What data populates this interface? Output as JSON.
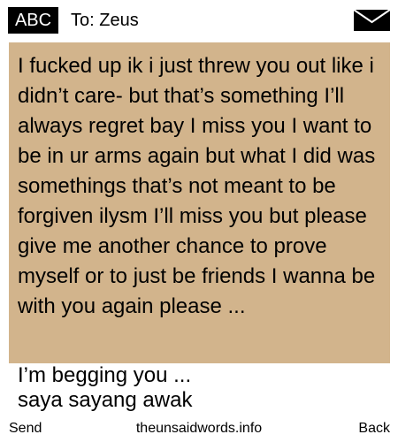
{
  "header": {
    "badge": "ABC",
    "to_label": "To: Zeus",
    "icon": "envelope-icon"
  },
  "message": {
    "body": "I fucked up ik i just threw you out like i didn’t care- but that’s something I’ll always regret bay I miss you I want to be in ur arms again but what I did was somethings that’s not meant to be forgiven ilysm I’ll miss you but please give me another chance to prove myself or to just be friends I wanna be with you again please ...",
    "continuation": [
      "I’m begging you ...",
      "saya sayang awak"
    ]
  },
  "footer": {
    "send_label": "Send",
    "site_label": "theunsaidwords.info",
    "back_label": "Back"
  },
  "colors": {
    "message_background": "#d2b48c",
    "badge_background": "#000000",
    "badge_text": "#ffffff",
    "text": "#000000",
    "page_background": "#ffffff"
  }
}
